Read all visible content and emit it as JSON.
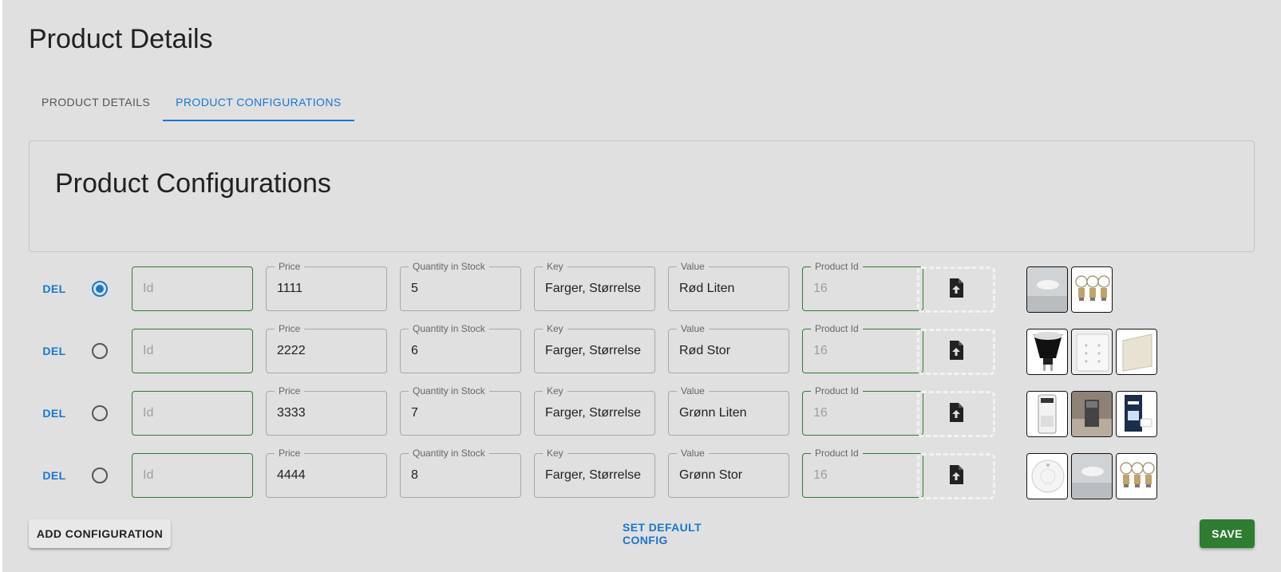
{
  "page": {
    "title": "Product Details"
  },
  "tabs": [
    {
      "label": "PRODUCT DETAILS",
      "active": false
    },
    {
      "label": "PRODUCT CONFIGURATIONS",
      "active": true
    }
  ],
  "section": {
    "title": "Product Configurations"
  },
  "field_labels": {
    "id_placeholder": "Id",
    "price": "Price",
    "quantity": "Quantity in Stock",
    "key": "Key",
    "value": "Value",
    "product_id": "Product Id"
  },
  "del_label": "DEL",
  "rows": [
    {
      "price": "1111",
      "quantity": "5",
      "key": "Farger, Størrelse",
      "value": "Rød Liten",
      "product_id": "16",
      "default": true,
      "images": [
        "ceiling-lamp",
        "three-bulbs"
      ]
    },
    {
      "price": "2222",
      "quantity": "6",
      "key": "Farger, Størrelse",
      "value": "Rød Stor",
      "product_id": "16",
      "default": false,
      "images": [
        "gu10-bulb",
        "wall-remote",
        "wall-panel"
      ]
    },
    {
      "price": "3333",
      "quantity": "7",
      "key": "Farger, Størrelse",
      "value": "Grønn Liten",
      "product_id": "16",
      "default": false,
      "images": [
        "portable-ac",
        "room-heater",
        "smart-hub-box"
      ]
    },
    {
      "price": "4444",
      "quantity": "8",
      "key": "Farger, Størrelse",
      "value": "Grønn Stor",
      "product_id": "16",
      "default": false,
      "images": [
        "smoke-detector",
        "ceiling-lamp",
        "three-bulbs"
      ]
    }
  ],
  "buttons": {
    "add_configuration": "ADD CONFIGURATION",
    "set_default": "SET DEFAULT CONFIG",
    "save": "SAVE"
  },
  "colors": {
    "background": "#e0e0e0",
    "primary": "#1976d2",
    "success": "#2e7d32"
  }
}
